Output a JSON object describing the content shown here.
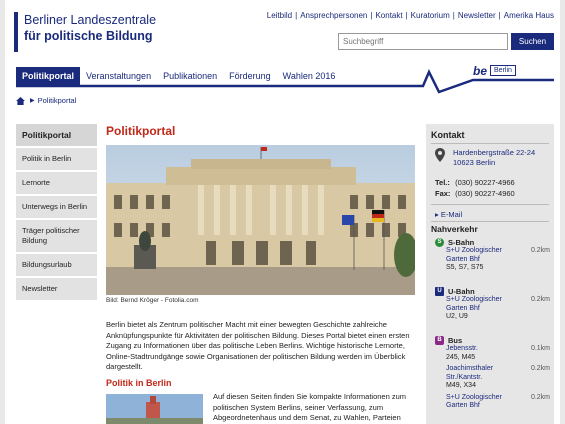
{
  "header": {
    "logo_line1": "Berliner Landeszentrale",
    "logo_line2": "für politische Bildung",
    "top_links": [
      "Leitbild",
      "Ansprechpersonen",
      "Kontakt",
      "Kuratorium",
      "Newsletter",
      "Amerika Haus"
    ],
    "search_placeholder": "Suchbegriff",
    "search_button": "Suchen"
  },
  "nav": {
    "items": [
      "Politikportal",
      "Veranstaltungen",
      "Publikationen",
      "Förderung",
      "Wahlen 2016"
    ],
    "active_index": 0,
    "be_logo": "be",
    "berlin_logo": "Berlin"
  },
  "breadcrumb": {
    "current": "Politikportal"
  },
  "sidebar": {
    "items": [
      "Politikportal",
      "Politik in Berlin",
      "Lernorte",
      "Unterwegs in Berlin",
      "Träger politischer Bildung",
      "Bildungsurlaub",
      "Newsletter"
    ]
  },
  "main": {
    "title": "Politikportal",
    "caption": "Bild: Bernd Kröger - Fotolia.com",
    "intro": "Berlin bietet als Zentrum politischer Macht mit einer bewegten Geschichte zahlreiche Anknüpfungspunkte für Aktivitäten der politischen Bildung. Dieses Portal bietet einen ersten Zugang zu Informationen über das politische Leben Berlins. Wichtige historische Lernorte, Online-Stadtrundgänge sowie Organisationen der politischen Bildung werden im Überblick dargestellt.",
    "sub_title": "Politik in Berlin",
    "sub_text": "Auf diesen Seiten finden Sie kompakte Informationen zum politischen System Berlins, seiner Verfassung, zum Abgeordnetenhaus und dem Senat, zu Wahlen, Parteien und"
  },
  "contact": {
    "title": "Kontakt",
    "address_line1": "Hardenbergstraße 22-24",
    "address_line2": "10623 Berlin",
    "tel_label": "Tel.:",
    "tel": "(030) 90227-4966",
    "fax_label": "Fax:",
    "fax": "(030) 90227-4960",
    "email": "E-Mail",
    "nahverkehr": "Nahverkehr",
    "transit": [
      {
        "type": "S-Bahn",
        "badge": "S",
        "stops": [
          {
            "name": "S+U Zoologischer Garten Bhf",
            "lines": "S5, S7, S75",
            "dist": "0.2km"
          }
        ]
      },
      {
        "type": "U-Bahn",
        "badge": "U",
        "stops": [
          {
            "name": "S+U Zoologischer Garten Bhf",
            "lines": "U2, U9",
            "dist": "0.2km"
          }
        ]
      },
      {
        "type": "Bus",
        "badge": "B",
        "stops": [
          {
            "name": "Jebensstr.",
            "lines": "245, M45",
            "dist": "0.1km"
          },
          {
            "name": "Joachimsthaler Str./Kantstr.",
            "lines": "M49, X34",
            "dist": "0.2km"
          },
          {
            "name": "S+U Zoologischer Garten Bhf",
            "lines": "",
            "dist": "0.2km"
          }
        ]
      }
    ]
  },
  "colors": {
    "brand": "#1a2a7c",
    "accent": "#c0281a",
    "sbahn": "#2c8a3a",
    "bus": "#8a2a86"
  }
}
